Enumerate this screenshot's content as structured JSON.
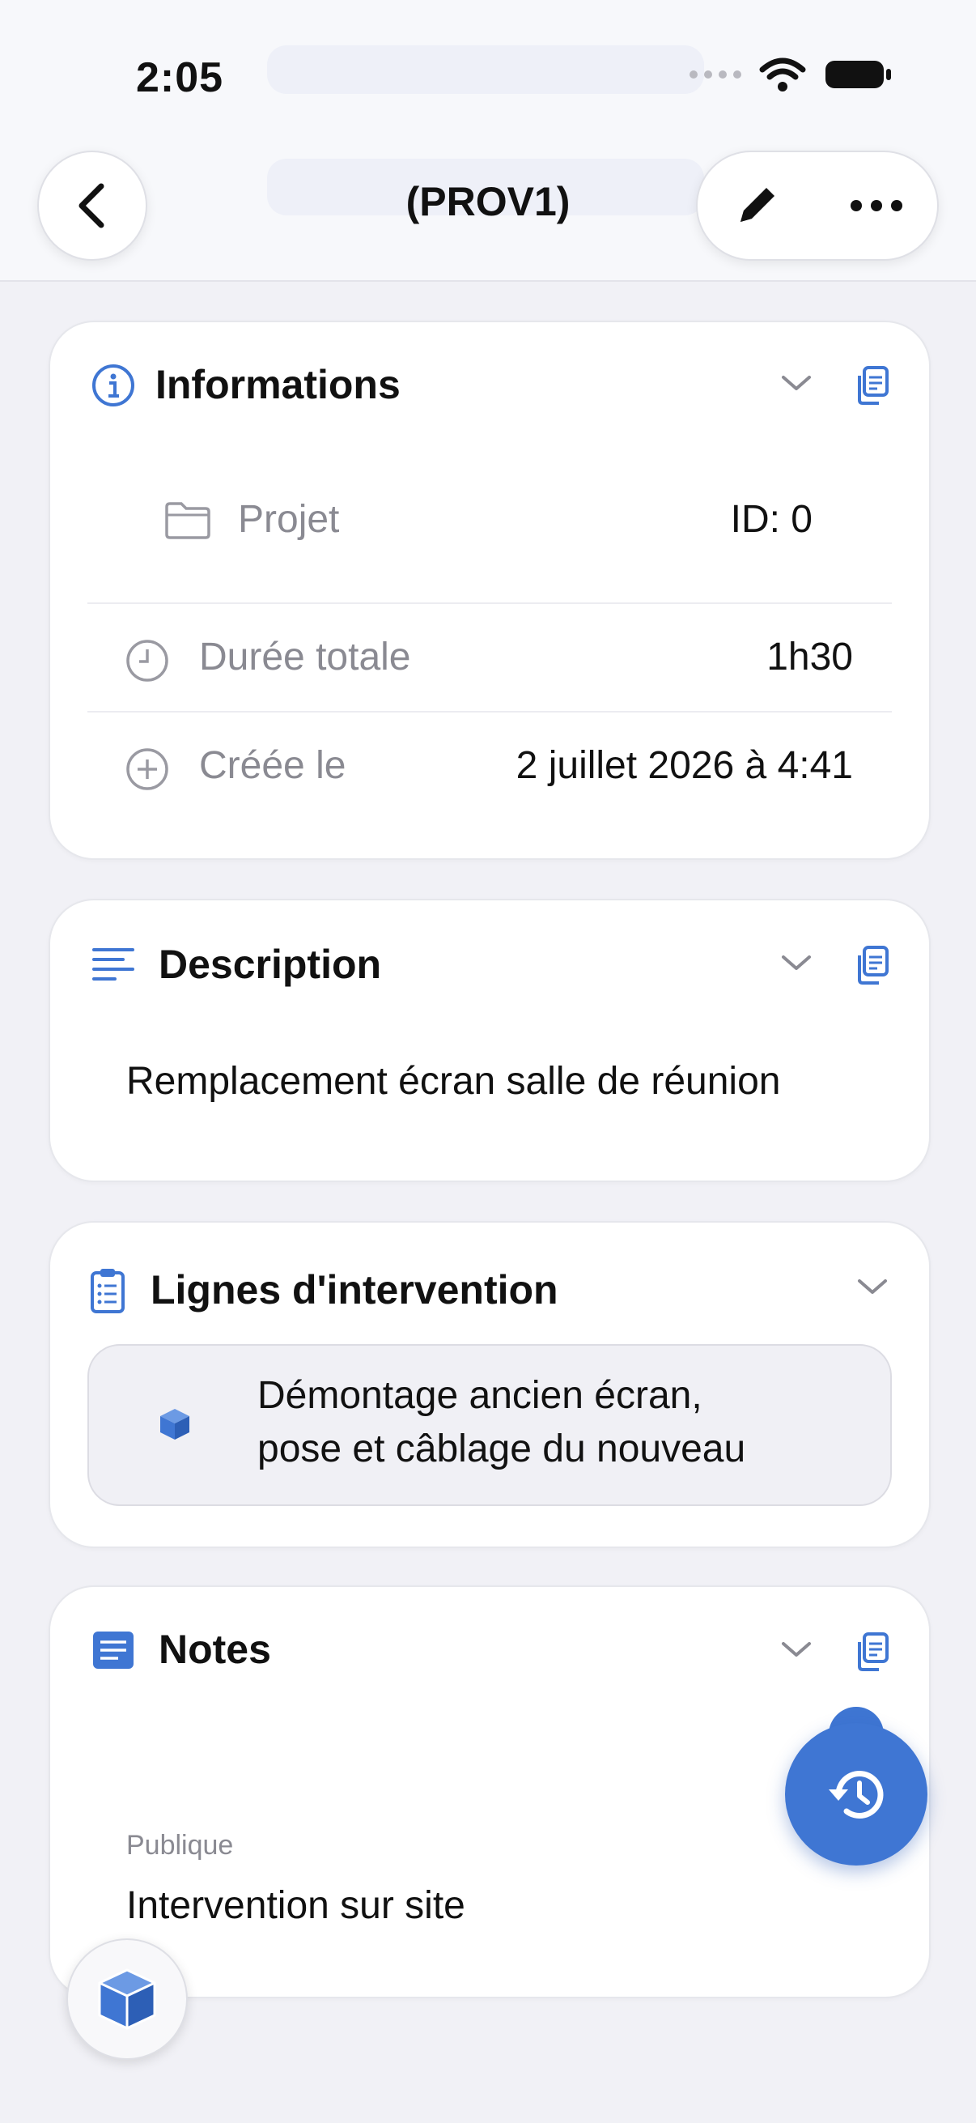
{
  "status_bar": {
    "time": "2:05"
  },
  "nav": {
    "title": "(PROV1)"
  },
  "informations": {
    "title": "Informations",
    "rows": [
      {
        "label": "Projet",
        "value": "ID: 0"
      },
      {
        "label": "Durée totale",
        "value": "1h30"
      },
      {
        "label": "Créée le",
        "value": "2 juillet 2026 à 4:41"
      }
    ]
  },
  "description": {
    "title": "Description",
    "text": "Remplacement écran salle de réunion"
  },
  "lignes": {
    "title": "Lignes d'intervention",
    "items": [
      {
        "line1": "Démontage ancien écran,",
        "line2": "pose et câblage du nouveau"
      }
    ]
  },
  "notes": {
    "title": "Notes",
    "label": "Publique",
    "text": "Intervention sur site"
  },
  "colors": {
    "accent": "#3f76d3",
    "background": "#f1f1f6",
    "card": "#ffffff"
  },
  "icons": [
    "chevron-left-icon",
    "pencil-icon",
    "ellipsis-icon",
    "info-icon",
    "chevron-down-icon",
    "copy-icon",
    "folder-icon",
    "clock-icon",
    "plus-circle-icon",
    "text-lines-icon",
    "clipboard-list-icon",
    "cube-icon",
    "note-icon",
    "history-icon"
  ]
}
